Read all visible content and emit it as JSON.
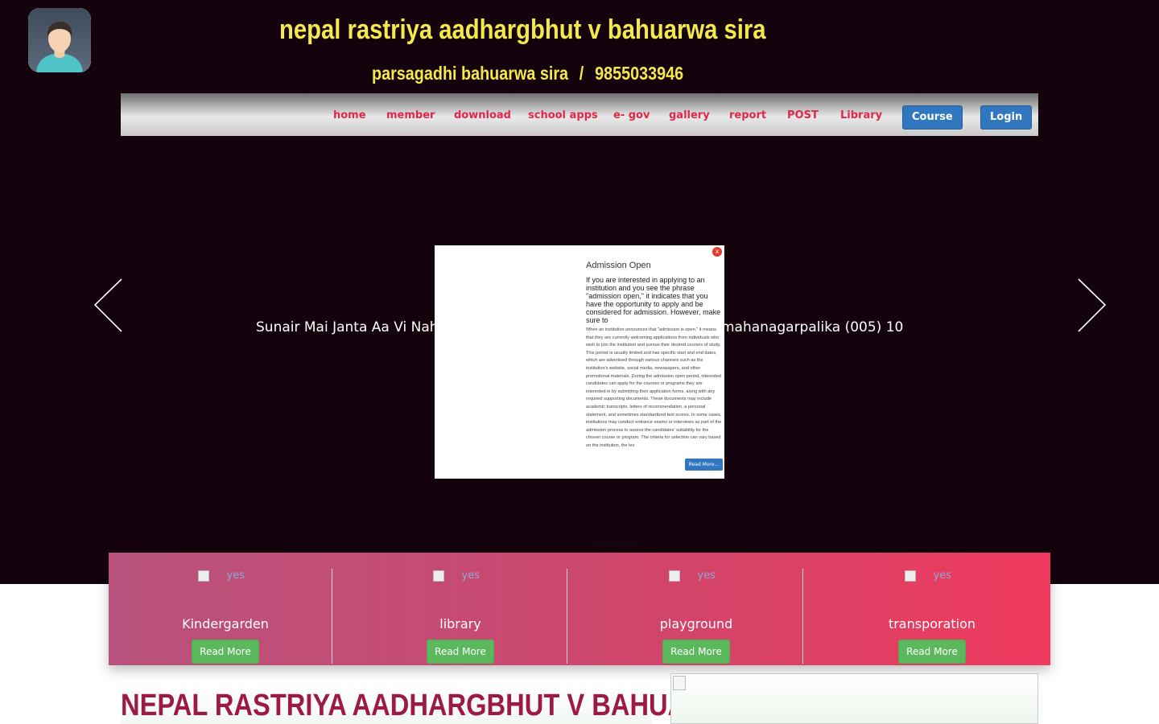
{
  "header": {
    "title": "nepal rastriya aadhargbhut v bahuarwa sira",
    "address": "parsagadhi bahuarwa sira",
    "separator": "/",
    "phone": "9855033946"
  },
  "nav": {
    "links": [
      "home",
      "member",
      "download",
      "school apps",
      "e- gov",
      "gallery",
      "report",
      "POST",
      "Library"
    ],
    "course_label": "Course",
    "login_label": "Login"
  },
  "slider": {
    "text_left": "Sunair Mai Janta Aa Vi Nah",
    "text_right": "mahanagarpalika (005) 10"
  },
  "popup": {
    "close": "x",
    "title": "Admission Open",
    "lead": "If you are interested in applying to an institution and you see the phrase \"admission open,\" it indicates that you have the opportunity to apply and be considered for admission. However, make sure to",
    "body": "When an institution announces that \"admission is open,\" it means that they are currently welcoming applications from individuals who wish to join the institution and pursue their desired courses of study. This period is usually limited and has specific start and end dates, which are advertised through various channels such as the institution's website, social media, newspapers, and other promotional materials. During the admission open period, interested candidates can apply for the courses or programs they are interested in by submitting their application forms, along with any required supporting documents. These documents may include academic transcripts, letters of recommendation, a personal statement, and sometimes standardized test scores. In some cases, institutions may conduct entrance exams or interviews as part of the admission process to assess the candidates' suitability for the chosen course or program. The criteria for selection can vary based on the institution, the lev",
    "read_more": "Read More..."
  },
  "features": [
    {
      "img_alt": "yes",
      "label": "Kindergarden",
      "button": "Read More"
    },
    {
      "img_alt": "yes",
      "label": "library",
      "button": "Read More"
    },
    {
      "img_alt": "yes",
      "label": "playground",
      "button": "Read More"
    },
    {
      "img_alt": "yes",
      "label": "transporation",
      "button": "Read More"
    }
  ],
  "section": {
    "heading": "NEPAL RASTRIYA AADHARGBHUT V BAHUARWA"
  },
  "colors": {
    "hero_bg": "#14020d",
    "title_yellow": "#f4e94a",
    "nav_link": "#e2264c",
    "nav_button": "#3077c0",
    "feature_button": "#5cb85c",
    "heading": "#9c1a45"
  }
}
